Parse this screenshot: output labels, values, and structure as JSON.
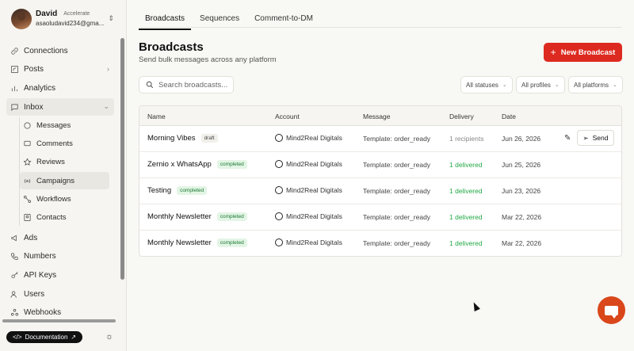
{
  "profile": {
    "name": "David",
    "plan": "Accelerate",
    "email": "asaoludavid234@gma..."
  },
  "sidebar": {
    "items": [
      {
        "label": "Connections",
        "icon": "link-icon"
      },
      {
        "label": "Posts",
        "icon": "edit-icon"
      },
      {
        "label": "Analytics",
        "icon": "bar-chart-icon"
      },
      {
        "label": "Inbox",
        "icon": "message-square-icon"
      }
    ],
    "inbox_sub": [
      {
        "label": "Messages",
        "icon": "chat-bubble-icon"
      },
      {
        "label": "Comments",
        "icon": "comment-icon"
      },
      {
        "label": "Reviews",
        "icon": "star-icon"
      },
      {
        "label": "Campaigns",
        "icon": "broadcast-icon"
      },
      {
        "label": "Workflows",
        "icon": "workflow-icon"
      },
      {
        "label": "Contacts",
        "icon": "contact-card-icon"
      }
    ],
    "items_after": [
      {
        "label": "Ads",
        "icon": "megaphone-icon"
      },
      {
        "label": "Numbers",
        "icon": "phone-icon"
      },
      {
        "label": "API Keys",
        "icon": "key-icon"
      },
      {
        "label": "Users",
        "icon": "users-icon"
      },
      {
        "label": "Webhooks",
        "icon": "webhook-icon"
      }
    ],
    "doc_label": "Documentation"
  },
  "tabs": [
    "Broadcasts",
    "Sequences",
    "Comment-to-DM"
  ],
  "header": {
    "title": "Broadcasts",
    "subtitle": "Send bulk messages across any platform",
    "new_button": "New Broadcast"
  },
  "search": {
    "placeholder": "Search broadcasts..."
  },
  "filters": [
    "All statuses",
    "All profiles",
    "All platforms"
  ],
  "table": {
    "columns": [
      "Name",
      "Account",
      "Message",
      "Delivery",
      "Date"
    ],
    "rows": [
      {
        "name": "Morning Vibes",
        "status": "draft",
        "account": "Mind2Real Digitals",
        "message": "Template: order_ready",
        "delivery": "1 recipients",
        "date": "Jun 26, 2026",
        "send_label": "Send"
      },
      {
        "name": "Zernio x WhatsApp",
        "status": "completed",
        "account": "Mind2Real Digitals",
        "message": "Template: order_ready",
        "delivery": "1 delivered",
        "date": "Jun 25, 2026"
      },
      {
        "name": "Testing",
        "status": "completed",
        "account": "Mind2Real Digitals",
        "message": "Template: order_ready",
        "delivery": "1 delivered",
        "date": "Jun 23, 2026"
      },
      {
        "name": "Monthly Newsletter",
        "status": "completed",
        "account": "Mind2Real Digitals",
        "message": "Template: order_ready",
        "delivery": "1 delivered",
        "date": "Mar 22, 2026"
      },
      {
        "name": "Monthly Newsletter",
        "status": "completed",
        "account": "Mind2Real Digitals",
        "message": "Template: order_ready",
        "delivery": "1 delivered",
        "date": "Mar 22, 2026"
      }
    ]
  },
  "colors": {
    "accent": "#dd2a20",
    "chat": "#d9471a",
    "delivered": "#22a845"
  }
}
